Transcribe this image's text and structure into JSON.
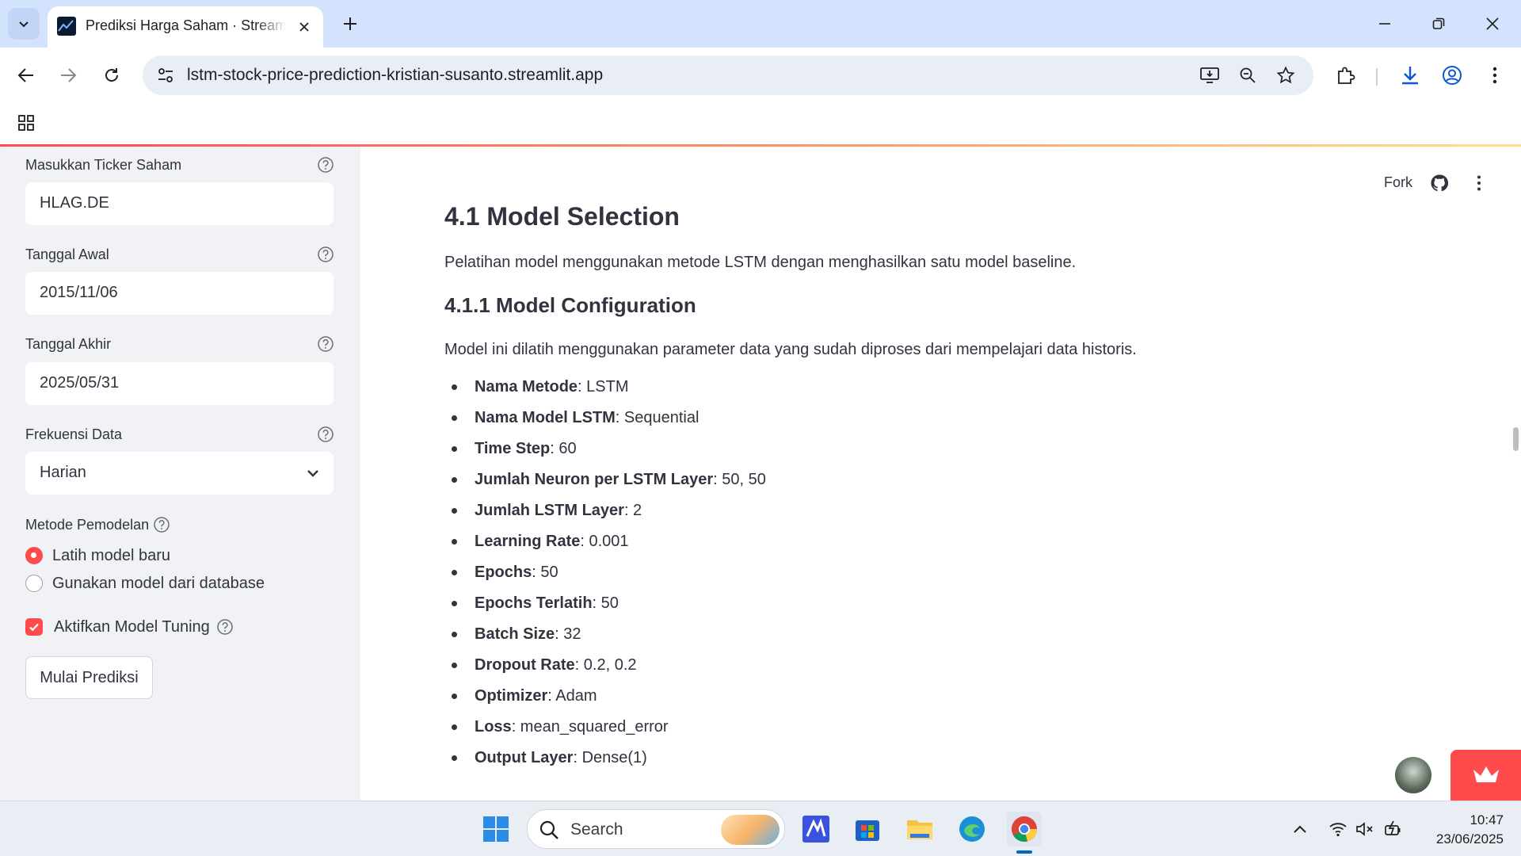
{
  "browser": {
    "tab_title": "Prediksi Harga Saham · Streamlit",
    "url": "lstm-stock-price-prediction-kristian-susanto.streamlit.app"
  },
  "sidebar": {
    "ticker": {
      "label": "Masukkan Ticker Saham",
      "value": "HLAG.DE"
    },
    "start_date": {
      "label": "Tanggal Awal",
      "value": "2015/11/06"
    },
    "end_date": {
      "label": "Tanggal Akhir",
      "value": "2025/05/31"
    },
    "frequency": {
      "label": "Frekuensi Data",
      "value": "Harian"
    },
    "method": {
      "label": "Metode Pemodelan",
      "options": [
        "Latih model baru",
        "Gunakan model dari database"
      ],
      "selected": "Latih model baru"
    },
    "tuning": {
      "label": "Aktifkan Model Tuning",
      "checked": true
    },
    "submit_label": "Mulai Prediksi"
  },
  "header": {
    "fork_label": "Fork"
  },
  "main": {
    "heading": "4.1 Model Selection",
    "intro": "Pelatihan model menggunakan metode LSTM dengan menghasilkan satu model baseline.",
    "subheading": "4.1.1 Model Configuration",
    "subintro": "Model ini dilatih menggunakan parameter data yang sudah diproses dari mempelajari data historis.",
    "config": [
      {
        "key": "Nama Metode",
        "value": ": LSTM"
      },
      {
        "key": "Nama Model LSTM",
        "value": ": Sequential"
      },
      {
        "key": "Time Step",
        "value": ": 60"
      },
      {
        "key": "Jumlah Neuron per LSTM Layer",
        "value": ": 50, 50"
      },
      {
        "key": "Jumlah LSTM Layer",
        "value": ": 2"
      },
      {
        "key": "Learning Rate",
        "value": ": 0.001"
      },
      {
        "key": "Epochs",
        "value": ": 50"
      },
      {
        "key": "Epochs Terlatih",
        "value": ": 50"
      },
      {
        "key": "Batch Size",
        "value": ": 32"
      },
      {
        "key": "Dropout Rate",
        "value": ": 0.2, 0.2"
      },
      {
        "key": "Optimizer",
        "value": ": Adam"
      },
      {
        "key": "Loss",
        "value": ": mean_squared_error"
      },
      {
        "key": "Output Layer",
        "value": ": Dense(1)"
      }
    ]
  },
  "taskbar": {
    "search_placeholder": "Search",
    "time": "10:47",
    "date": "23/06/2025"
  },
  "colors": {
    "accent": "#ff4b4b",
    "sidebar_bg": "#f0f2f6",
    "text": "#31333f",
    "chrome_tab_bg": "#d3e3fd"
  }
}
